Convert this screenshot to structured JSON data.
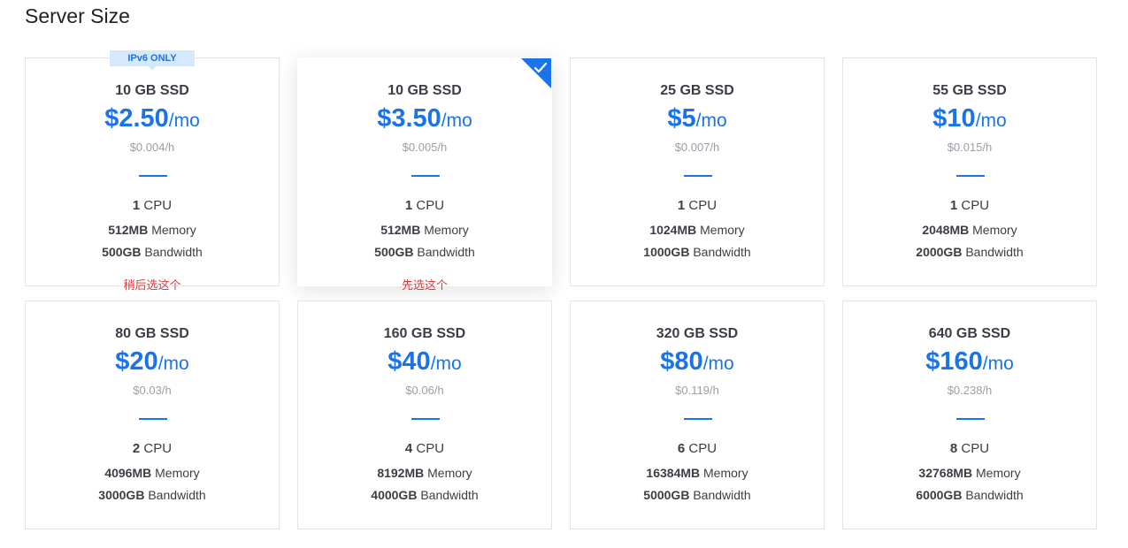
{
  "section_title": "Server Size",
  "accent_color": "#1a73e8",
  "cards": [
    {
      "ssd": "10 GB SSD",
      "price": "$2.50",
      "per": "/mo",
      "hourly": "$0.004/h",
      "cpu": "1",
      "cpu_label": "CPU",
      "memory": "512MB",
      "memory_label": "Memory",
      "bandwidth": "500GB",
      "bandwidth_label": "Bandwidth",
      "badge": "IPv6 ONLY",
      "note": "稍后选这个",
      "selected": false
    },
    {
      "ssd": "10 GB SSD",
      "price": "$3.50",
      "per": "/mo",
      "hourly": "$0.005/h",
      "cpu": "1",
      "cpu_label": "CPU",
      "memory": "512MB",
      "memory_label": "Memory",
      "bandwidth": "500GB",
      "bandwidth_label": "Bandwidth",
      "note": "先选这个",
      "selected": true
    },
    {
      "ssd": "25 GB SSD",
      "price": "$5",
      "per": "/mo",
      "hourly": "$0.007/h",
      "cpu": "1",
      "cpu_label": "CPU",
      "memory": "1024MB",
      "memory_label": "Memory",
      "bandwidth": "1000GB",
      "bandwidth_label": "Bandwidth",
      "selected": false
    },
    {
      "ssd": "55 GB SSD",
      "price": "$10",
      "per": "/mo",
      "hourly": "$0.015/h",
      "cpu": "1",
      "cpu_label": "CPU",
      "memory": "2048MB",
      "memory_label": "Memory",
      "bandwidth": "2000GB",
      "bandwidth_label": "Bandwidth",
      "selected": false
    },
    {
      "ssd": "80 GB SSD",
      "price": "$20",
      "per": "/mo",
      "hourly": "$0.03/h",
      "cpu": "2",
      "cpu_label": "CPU",
      "memory": "4096MB",
      "memory_label": "Memory",
      "bandwidth": "3000GB",
      "bandwidth_label": "Bandwidth",
      "selected": false
    },
    {
      "ssd": "160 GB SSD",
      "price": "$40",
      "per": "/mo",
      "hourly": "$0.06/h",
      "cpu": "4",
      "cpu_label": "CPU",
      "memory": "8192MB",
      "memory_label": "Memory",
      "bandwidth": "4000GB",
      "bandwidth_label": "Bandwidth",
      "selected": false
    },
    {
      "ssd": "320 GB SSD",
      "price": "$80",
      "per": "/mo",
      "hourly": "$0.119/h",
      "cpu": "6",
      "cpu_label": "CPU",
      "memory": "16384MB",
      "memory_label": "Memory",
      "bandwidth": "5000GB",
      "bandwidth_label": "Bandwidth",
      "selected": false
    },
    {
      "ssd": "640 GB SSD",
      "price": "$160",
      "per": "/mo",
      "hourly": "$0.238/h",
      "cpu": "8",
      "cpu_label": "CPU",
      "memory": "32768MB",
      "memory_label": "Memory",
      "bandwidth": "6000GB",
      "bandwidth_label": "Bandwidth",
      "selected": false
    }
  ]
}
